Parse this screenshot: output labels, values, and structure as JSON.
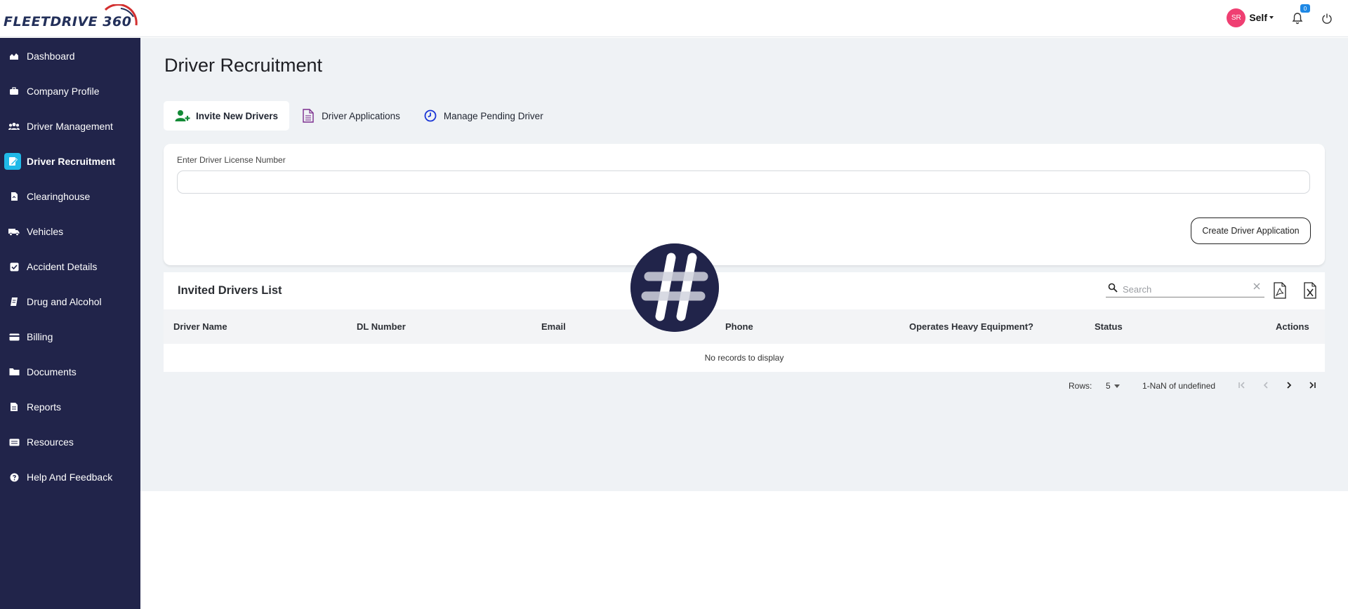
{
  "header": {
    "logo_text": "FLEETDRIVE 360",
    "avatar_initials": "SR",
    "user_label": "Self",
    "notification_count": "0",
    "icons": [
      "chevron-down-icon",
      "bell-icon",
      "power-icon"
    ]
  },
  "sidebar": {
    "items": [
      {
        "label": "Dashboard",
        "icon": "chart-icon"
      },
      {
        "label": "Company Profile",
        "icon": "briefcase-icon"
      },
      {
        "label": "Driver Management",
        "icon": "users-icon"
      },
      {
        "label": "Driver Recruitment",
        "icon": "signature-icon",
        "active": true
      },
      {
        "label": "Clearinghouse",
        "icon": "file-icon"
      },
      {
        "label": "Vehicles",
        "icon": "truck-icon"
      },
      {
        "label": "Accident Details",
        "icon": "check-square-icon"
      },
      {
        "label": "Drug and Alcohol",
        "icon": "document-icon"
      },
      {
        "label": "Billing",
        "icon": "credit-card-icon"
      },
      {
        "label": "Documents",
        "icon": "folder-icon"
      },
      {
        "label": "Reports",
        "icon": "file-text-icon"
      },
      {
        "label": "Resources",
        "icon": "newspaper-icon"
      },
      {
        "label": "Help And Feedback",
        "icon": "question-circle-icon"
      }
    ]
  },
  "main": {
    "title": "Driver Recruitment",
    "tabs": [
      {
        "label": "Invite New Drivers",
        "icon": "user-plus-icon",
        "active": true
      },
      {
        "label": "Driver Applications",
        "icon": "document-icon"
      },
      {
        "label": "Manage Pending Driver",
        "icon": "clock-icon"
      }
    ],
    "license_form": {
      "label": "Enter Driver License Number",
      "value": "",
      "button_label": "Create Driver Application"
    },
    "invited_list": {
      "title": "Invited Drivers List",
      "search_placeholder": "Search",
      "columns": [
        "Driver Name",
        "DL Number",
        "Email",
        "Phone",
        "Operates Heavy Equipment?",
        "Status",
        "Actions"
      ],
      "rows": [],
      "empty_message": "No records to display"
    },
    "pagination": {
      "rows_label": "Rows:",
      "rows_per_page": "5",
      "range_text": "1-NaN of undefined"
    }
  },
  "colors": {
    "sidebar_bg": "#21244a",
    "active_icon_bg": "#20b9e8",
    "avatar_bg": "#ef3f72",
    "badge_bg": "#1e88e5",
    "main_bg": "#eff2f5"
  }
}
